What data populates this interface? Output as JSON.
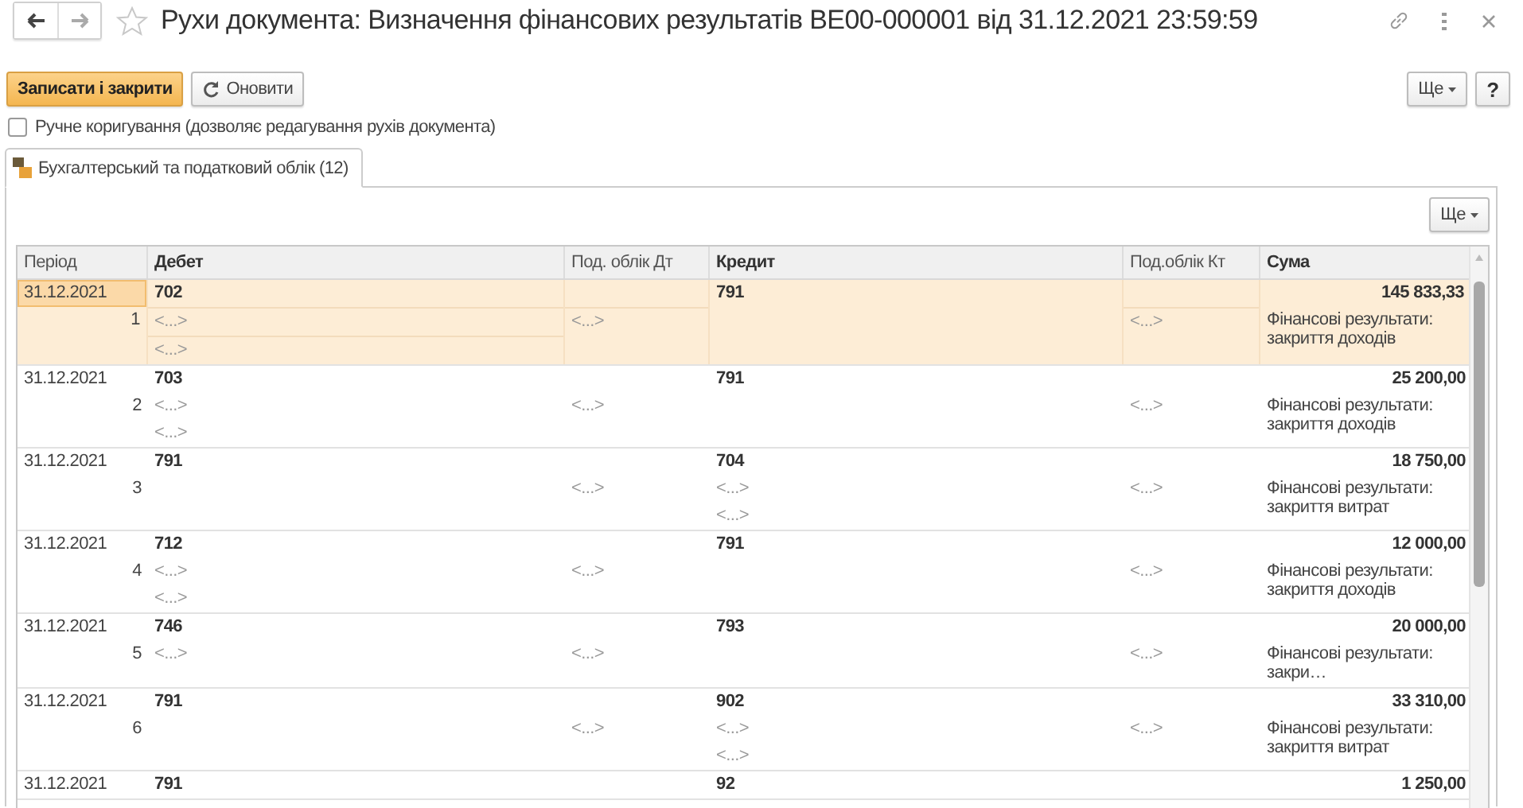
{
  "window": {
    "title": "Рухи документа: Визначення фінансових результатів BE00-000001 від 31.12.2021 23:59:59"
  },
  "toolbar": {
    "buttons": [
      {
        "label": "Записати і закрити",
        "kind": "primary"
      },
      {
        "label": "Оновити",
        "kind": "refresh"
      }
    ],
    "more": "Ще",
    "help": "?"
  },
  "manual_edit": {
    "label": "Ручне коригування (дозволяє редагування рухів документа)",
    "checked": false
  },
  "tabs": [
    {
      "label": "Бухгалтерський та податковий облік (12)",
      "selected": true
    }
  ],
  "table_panel": {
    "more": "Ще"
  },
  "table": {
    "columns": [
      "Період",
      "Дебет",
      "Под. облік Дт",
      "Кредит",
      "Под.облік Кт",
      "Сума"
    ],
    "rows": [
      {
        "selected": true,
        "period": "31.12.2021",
        "number": "1",
        "debit": "702",
        "debit_subconto": [
          "<...>",
          "<...>"
        ],
        "debit_tax": "<...>",
        "credit": "791",
        "credit_subconto": [],
        "credit_tax": "<...>",
        "amount": "145 833,33",
        "content": "Фінансові результати: закриття доходів"
      },
      {
        "selected": false,
        "period": "31.12.2021",
        "number": "2",
        "debit": "703",
        "debit_subconto": [
          "<...>",
          "<...>"
        ],
        "debit_tax": "<...>",
        "credit": "791",
        "credit_subconto": [],
        "credit_tax": "<...>",
        "amount": "25 200,00",
        "content": "Фінансові результати: закриття доходів"
      },
      {
        "selected": false,
        "period": "31.12.2021",
        "number": "3",
        "debit": "791",
        "debit_subconto": [],
        "debit_tax": "<...>",
        "credit": "704",
        "credit_subconto": [
          "<...>",
          "<...>"
        ],
        "credit_tax": "<...>",
        "amount": "18 750,00",
        "content": "Фінансові результати: закриття витрат"
      },
      {
        "selected": false,
        "period": "31.12.2021",
        "number": "4",
        "debit": "712",
        "debit_subconto": [
          "<...>",
          "<...>"
        ],
        "debit_tax": "<...>",
        "credit": "791",
        "credit_subconto": [],
        "credit_tax": "<...>",
        "amount": "12 000,00",
        "content": "Фінансові результати: закриття доходів"
      },
      {
        "selected": false,
        "period": "31.12.2021",
        "number": "5",
        "debit": "746",
        "debit_subconto": [
          "<...>"
        ],
        "debit_tax": "<...>",
        "credit": "793",
        "credit_subconto": [],
        "credit_tax": "<...>",
        "amount": "20 000,00",
        "content": "Фінансові результати: закри…"
      },
      {
        "selected": false,
        "period": "31.12.2021",
        "number": "6",
        "debit": "791",
        "debit_subconto": [],
        "debit_tax": "<...>",
        "credit": "902",
        "credit_subconto": [
          "<...>",
          "<...>"
        ],
        "credit_tax": "<...>",
        "amount": "33 310,00",
        "content": "Фінансові результати: закриття витрат"
      },
      {
        "selected": false,
        "period": "31.12.2021",
        "debit": "791",
        "credit": "92",
        "amount": "1 250,00"
      }
    ]
  }
}
